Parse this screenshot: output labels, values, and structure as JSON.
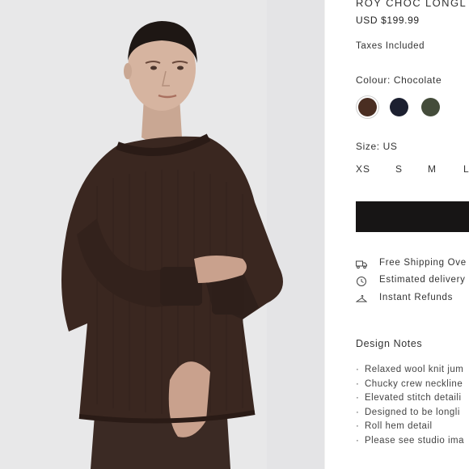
{
  "product": {
    "title": "ROY CHOC LONGL",
    "price": "USD $199.99",
    "taxes_note": "Taxes Included"
  },
  "colour": {
    "label": "Colour: Chocolate",
    "swatches": [
      {
        "name": "chocolate",
        "hex": "#4a2e22",
        "selected": true
      },
      {
        "name": "navy",
        "hex": "#1c2030",
        "selected": false
      },
      {
        "name": "olive",
        "hex": "#444c3a",
        "selected": false
      }
    ]
  },
  "size": {
    "label": "Size: US",
    "options": [
      "XS",
      "S",
      "M",
      "L"
    ]
  },
  "add_to_cart": {
    "color": "#171515"
  },
  "features": [
    {
      "icon": "truck-icon",
      "text": "Free Shipping Ove"
    },
    {
      "icon": "clock-icon",
      "text": "Estimated delivery"
    },
    {
      "icon": "hanger-icon",
      "text": "Instant Refunds"
    }
  ],
  "design_notes": {
    "heading": "Design Notes",
    "items": [
      "Relaxed wool knit jum",
      "Chucky crew neckline",
      "Elevated stitch detaili",
      "Designed to be longli",
      "Roll hem detail",
      "Please see studio ima"
    ]
  },
  "image": {
    "alt": "",
    "background": "#e9e9ea",
    "sweater_color": "#3a2720"
  }
}
